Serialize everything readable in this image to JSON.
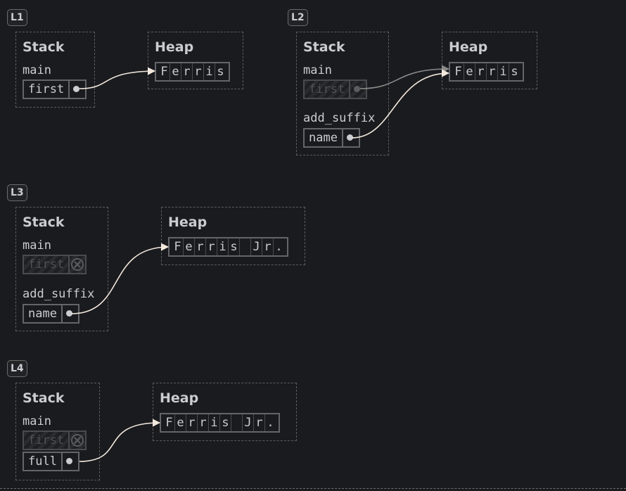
{
  "steps": [
    {
      "label": "L1",
      "stack_title": "Stack",
      "heap_title": "Heap",
      "frames": [
        {
          "name": "main",
          "vars": [
            {
              "name": "first",
              "state": "pointer"
            }
          ]
        }
      ],
      "heap_string": [
        "F",
        "e",
        "r",
        "r",
        "i",
        "s"
      ]
    },
    {
      "label": "L2",
      "stack_title": "Stack",
      "heap_title": "Heap",
      "frames": [
        {
          "name": "main",
          "vars": [
            {
              "name": "first",
              "state": "moved-pointer"
            }
          ]
        },
        {
          "name": "add_suffix",
          "vars": [
            {
              "name": "name",
              "state": "pointer"
            }
          ]
        }
      ],
      "heap_string": [
        "F",
        "e",
        "r",
        "r",
        "i",
        "s"
      ]
    },
    {
      "label": "L3",
      "stack_title": "Stack",
      "heap_title": "Heap",
      "frames": [
        {
          "name": "main",
          "vars": [
            {
              "name": "first",
              "state": "invalid"
            }
          ]
        },
        {
          "name": "add_suffix",
          "vars": [
            {
              "name": "name",
              "state": "pointer"
            }
          ]
        }
      ],
      "heap_string": [
        "F",
        "e",
        "r",
        "r",
        "i",
        "s",
        " ",
        "J",
        "r",
        "."
      ]
    },
    {
      "label": "L4",
      "stack_title": "Stack",
      "heap_title": "Heap",
      "frames": [
        {
          "name": "main",
          "vars": [
            {
              "name": "first",
              "state": "invalid"
            },
            {
              "name": "full",
              "state": "pointer"
            }
          ]
        }
      ],
      "heap_string": [
        "F",
        "e",
        "r",
        "r",
        "i",
        "s",
        " ",
        "J",
        "r",
        "."
      ]
    }
  ],
  "colors": {
    "background": "#1a1b1e",
    "text": "#c9ccd0",
    "arrow": "#f2e8de",
    "arrow_faded": "#8a8a8a"
  }
}
